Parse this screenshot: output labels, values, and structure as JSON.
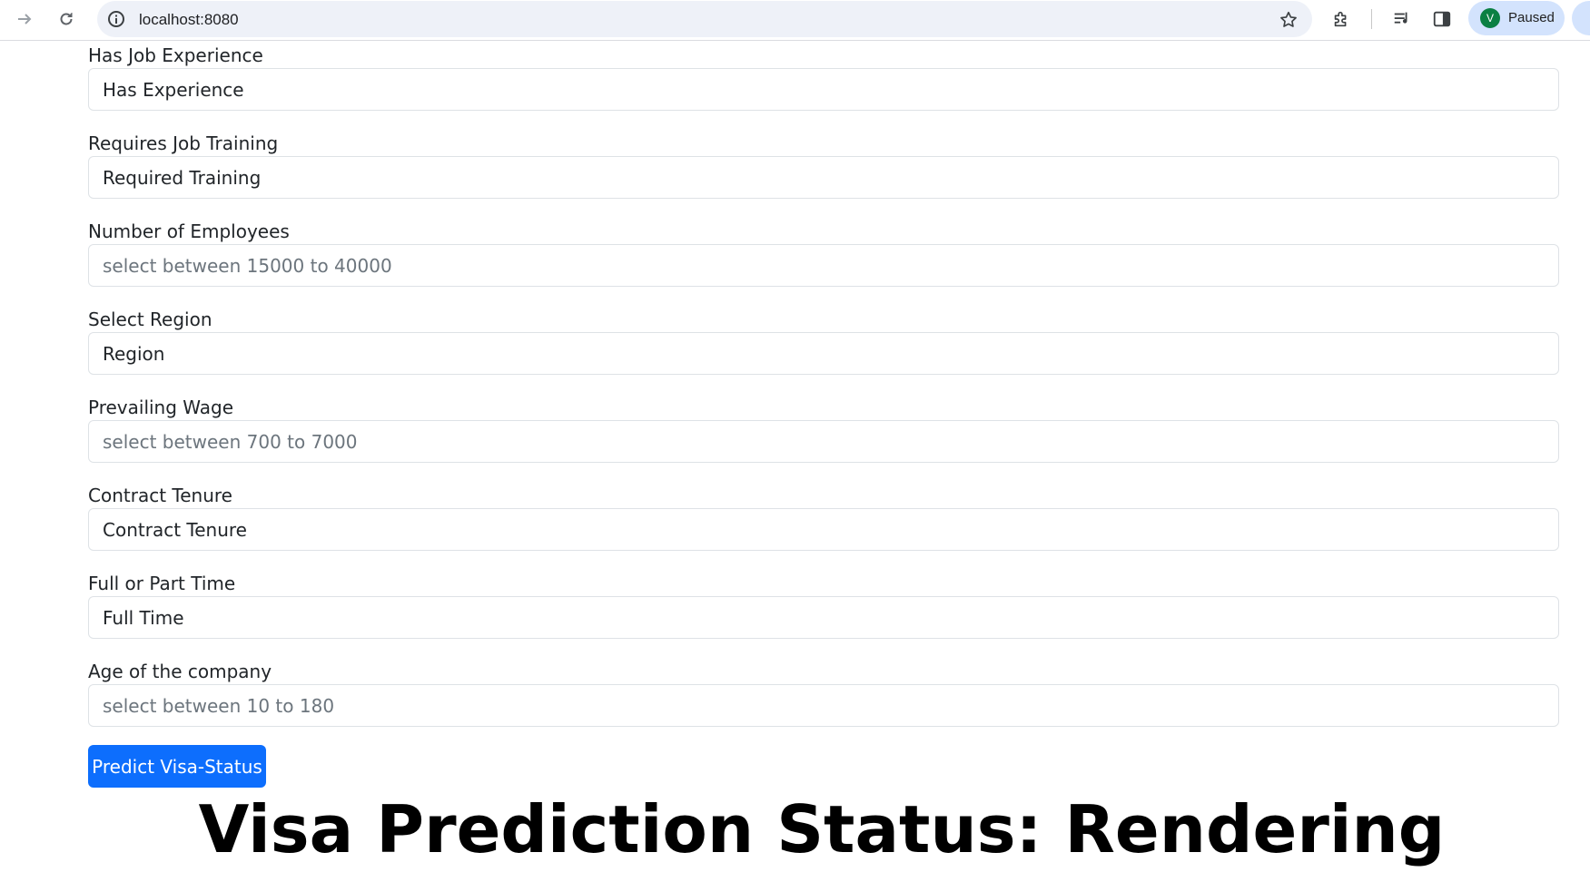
{
  "browser": {
    "url": "localhost:8080",
    "profile_initial": "V",
    "profile_status": "Paused",
    "avatar_color": "#0b8043",
    "icons": [
      "forward-icon",
      "reload-icon",
      "site-info-icon",
      "bookmark-star-icon",
      "extensions-icon",
      "media-controls-icon",
      "side-panel-icon"
    ]
  },
  "form": {
    "fields": [
      {
        "label": "Has Job Experience",
        "value": "Has Experience",
        "placeholder": ""
      },
      {
        "label": "Requires Job Training",
        "value": "Required Training",
        "placeholder": ""
      },
      {
        "label": "Number of Employees",
        "value": "",
        "placeholder": "select between 15000 to 40000"
      },
      {
        "label": "Select Region",
        "value": "Region",
        "placeholder": ""
      },
      {
        "label": "Prevailing Wage",
        "value": "",
        "placeholder": "select between 700 to 7000"
      },
      {
        "label": "Contract Tenure",
        "value": "Contract Tenure",
        "placeholder": ""
      },
      {
        "label": "Full or Part Time",
        "value": "Full Time",
        "placeholder": ""
      },
      {
        "label": "Age of the company",
        "value": "",
        "placeholder": "select between 10 to 180"
      }
    ],
    "submit_label": "Predict Visa-Status",
    "submit_color": "#0d6efd"
  },
  "result": {
    "heading": "Visa Prediction Status: Rendering"
  }
}
